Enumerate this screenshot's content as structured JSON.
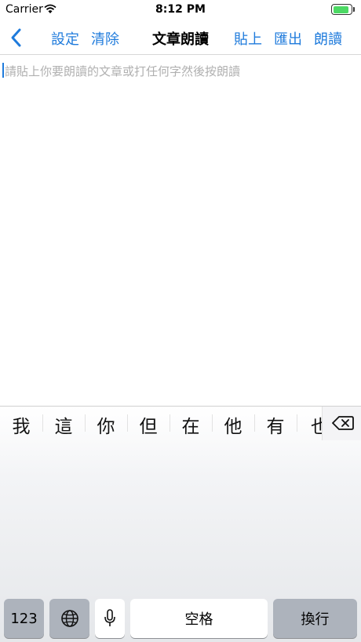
{
  "status_bar": {
    "carrier": "Carrier",
    "time": "8:12 PM",
    "battery_level_fraction": 0.9
  },
  "nav": {
    "settings": "設定",
    "clear": "清除",
    "title": "文章朗讀",
    "paste": "貼上",
    "export": "匯出",
    "read": "朗讀"
  },
  "editor": {
    "placeholder": "請貼上你要朗讀的文章或打任何字然後按朗讀"
  },
  "keyboard": {
    "candidates": [
      "我",
      "這",
      "你",
      "但",
      "在",
      "他",
      "有",
      "也"
    ],
    "numbers_key": "123",
    "space_key": "空格",
    "return_key": "換行",
    "icons": [
      "globe-icon",
      "microphone-icon",
      "delete-icon"
    ]
  }
}
